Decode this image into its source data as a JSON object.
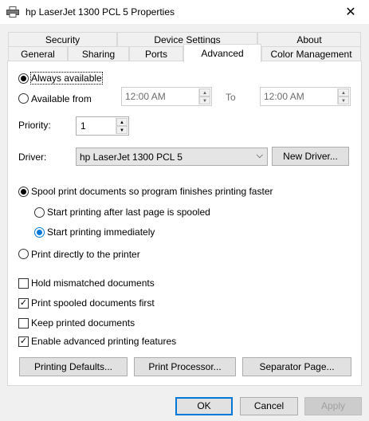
{
  "window": {
    "title": "hp LaserJet 1300 PCL 5 Properties",
    "close_symbol": "✕"
  },
  "tabs_row1": [
    "Security",
    "Device Settings",
    "About"
  ],
  "tabs_row2": [
    "General",
    "Sharing",
    "Ports",
    "Advanced",
    "Color Management"
  ],
  "active_tab": "Advanced",
  "availability": {
    "always_label": "Always available",
    "from_label": "Available from",
    "from_time": "12:00 AM",
    "to_label": "To",
    "to_time": "12:00 AM"
  },
  "priority": {
    "label": "Priority:",
    "value": "1"
  },
  "driver": {
    "label": "Driver:",
    "value": "hp LaserJet 1300 PCL 5",
    "new_driver_label": "New Driver..."
  },
  "spool": {
    "spool_label": "Spool print documents so program finishes printing faster",
    "after_last_label": "Start printing after last page is spooled",
    "immediately_label": "Start printing immediately",
    "direct_label": "Print directly to the printer"
  },
  "options": {
    "hold_label": "Hold mismatched documents",
    "spooled_first_label": "Print spooled documents first",
    "keep_label": "Keep printed documents",
    "advanced_features_label": "Enable advanced printing features"
  },
  "panel_buttons": {
    "defaults": "Printing Defaults...",
    "processor": "Print Processor...",
    "separator": "Separator Page..."
  },
  "dialog_buttons": {
    "ok": "OK",
    "cancel": "Cancel",
    "apply": "Apply"
  }
}
